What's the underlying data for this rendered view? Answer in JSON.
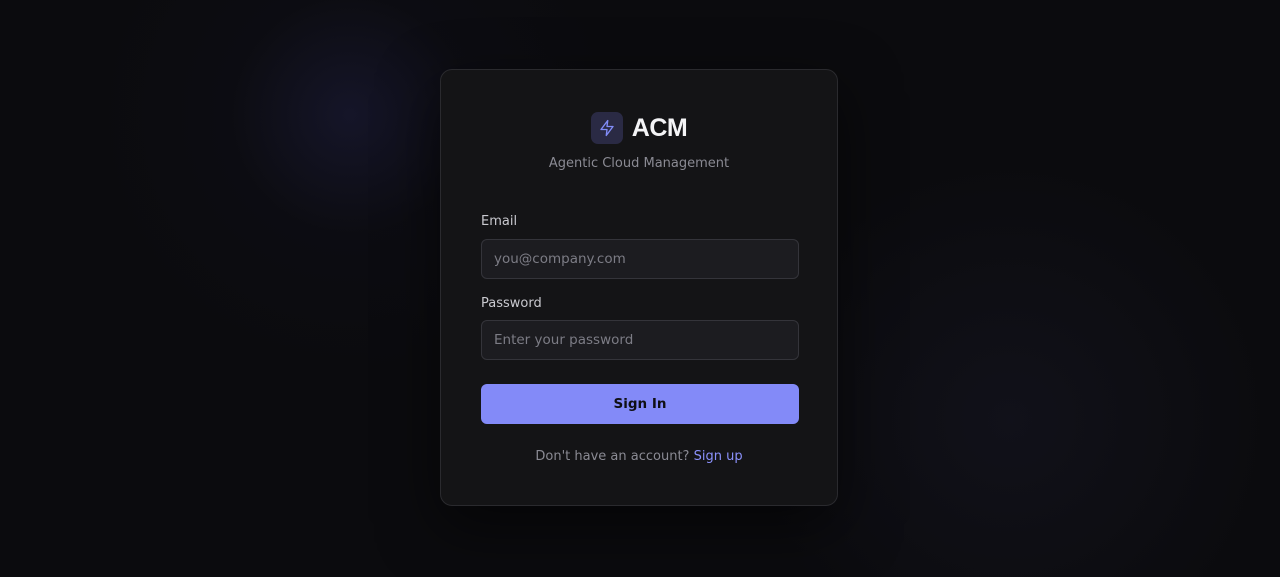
{
  "brand": {
    "name": "ACM",
    "tagline": "Agentic Cloud Management",
    "icon": "lightning-bolt-icon",
    "accent_color": "#818cf8"
  },
  "form": {
    "email_label": "Email",
    "email_placeholder": "you@company.com",
    "email_value": "",
    "password_label": "Password",
    "password_placeholder": "Enter your password",
    "password_value": "",
    "submit_label": "Sign In",
    "submit_color": "#838af8"
  },
  "footer": {
    "prompt": "Don't have an account?",
    "link_label": "Sign up"
  }
}
